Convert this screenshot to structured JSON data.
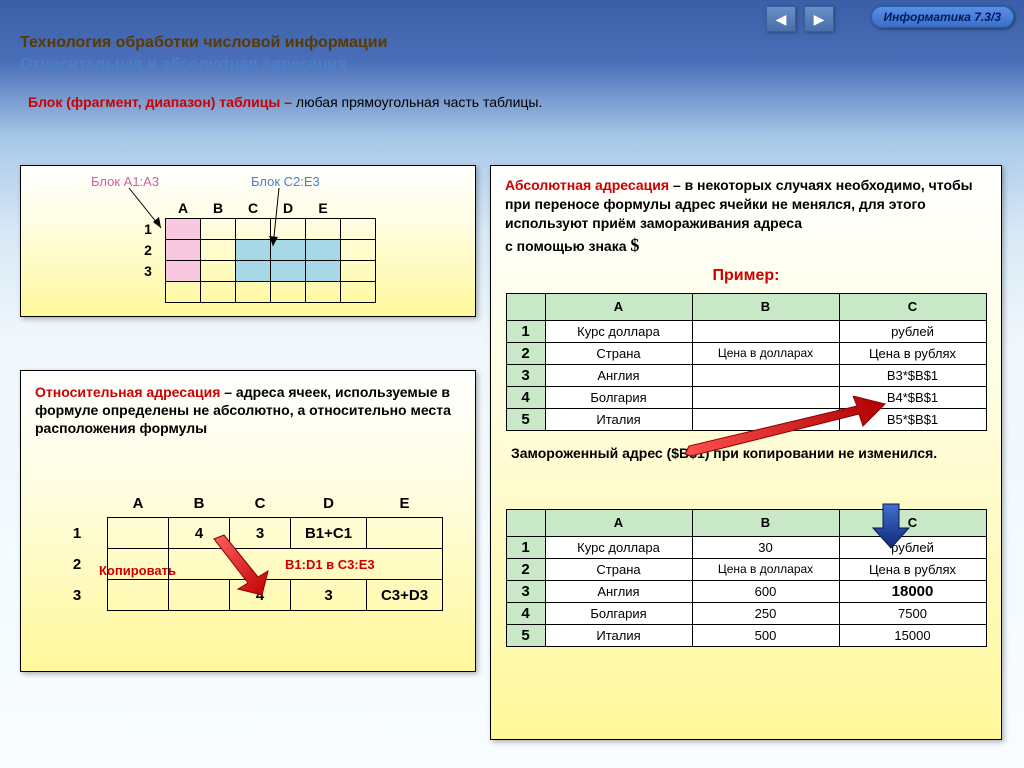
{
  "header": {
    "badge": "Информатика  7.3/3",
    "title1": "Технология обработки числовой информации",
    "title2": "Относительная и абсолютная адресация"
  },
  "block_def": {
    "red": "Блок (фрагмент, диапазон) таблицы –",
    "rest": " любая прямоугольная часть таблицы."
  },
  "left1": {
    "label_a": "Блок A1:A3",
    "label_b": "Блок C2:E3",
    "cols": [
      "A",
      "B",
      "C",
      "D",
      "E"
    ],
    "rows": [
      "1",
      "2",
      "3"
    ]
  },
  "relative": {
    "title_red": "Относительная адресация",
    "text": " – адреса ячеек, используемые в формуле определены не абсолютно, а относительно места расположения формулы",
    "cols": [
      "A",
      "B",
      "C",
      "D",
      "E"
    ],
    "rows": [
      "1",
      "2",
      "3"
    ],
    "data_row1": [
      "",
      "4",
      "3",
      "B1+C1",
      ""
    ],
    "data_row3": [
      "",
      "",
      "4",
      "3",
      "C3+D3"
    ],
    "copy_label": "Копировать",
    "copy_range": "B1:D1 в C3:E3"
  },
  "absolute": {
    "title_red": "Абсолютная адресация",
    "text1": " – в некоторых случаях необходимо, чтобы при переносе формулы адрес ячейки не менялся, для этого используют приём замораживания адреса",
    "text2_prefix": "с помощью знака ",
    "dollar": "$",
    "example": "Пример:",
    "table1": {
      "cols": [
        "A",
        "B",
        "C"
      ],
      "rows": [
        [
          "1",
          "Курс доллара",
          "",
          "рублей"
        ],
        [
          "2",
          "Страна",
          "Цена в долларах",
          "Цена в рублях"
        ],
        [
          "3",
          "Англия",
          "",
          "B3*$B$1"
        ],
        [
          "4",
          "Болгария",
          "",
          "B4*$B$1"
        ],
        [
          "5",
          "Италия",
          "",
          "B5*$B$1"
        ]
      ]
    },
    "frozen": "Замороженный адрес ($B$1) при копировании не изменился.",
    "table2": {
      "cols": [
        "A",
        "B",
        "C"
      ],
      "rows": [
        [
          "1",
          "Курс доллара",
          "30",
          "рублей"
        ],
        [
          "2",
          "Страна",
          "Цена в долларах",
          "Цена в рублях"
        ],
        [
          "3",
          "Англия",
          "600",
          "18000"
        ],
        [
          "4",
          "Болгария",
          "250",
          "7500"
        ],
        [
          "5",
          "Италия",
          "500",
          "15000"
        ]
      ]
    }
  }
}
